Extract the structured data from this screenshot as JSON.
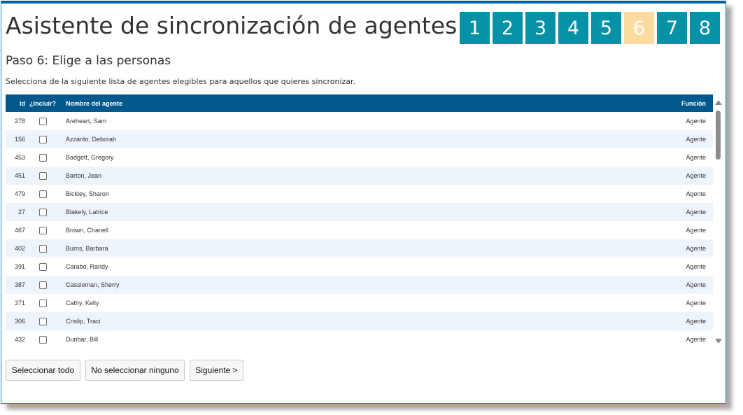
{
  "title": "Asistente de sincronización de agentes",
  "steps": [
    {
      "label": "1",
      "current": false
    },
    {
      "label": "2",
      "current": false
    },
    {
      "label": "3",
      "current": false
    },
    {
      "label": "4",
      "current": false
    },
    {
      "label": "5",
      "current": false
    },
    {
      "label": "6",
      "current": true
    },
    {
      "label": "7",
      "current": false
    },
    {
      "label": "8",
      "current": false
    }
  ],
  "subtitle": "Paso 6: Elige a las personas",
  "instructions": "Selecciona de la siguiente lista de agentes elegibles para aquellos que quieres sincronizar.",
  "table": {
    "headers": {
      "id": "Id",
      "include": "¿Incluir?",
      "name": "Nombre del agente",
      "function": "Función"
    },
    "rows": [
      {
        "id": "278",
        "name": "Areheart, Sam",
        "function": "Agente",
        "included": false
      },
      {
        "id": "156",
        "name": "Azzarito, Deborah",
        "function": "Agente",
        "included": false
      },
      {
        "id": "453",
        "name": "Badgett, Gregory",
        "function": "Agente",
        "included": false
      },
      {
        "id": "451",
        "name": "Barton, Jean",
        "function": "Agente",
        "included": false
      },
      {
        "id": "479",
        "name": "Bickley, Sharon",
        "function": "Agente",
        "included": false
      },
      {
        "id": "27",
        "name": "Blakely, Latrice",
        "function": "Agente",
        "included": false
      },
      {
        "id": "467",
        "name": "Brown, Chanell",
        "function": "Agente",
        "included": false
      },
      {
        "id": "402",
        "name": "Burns, Barbara",
        "function": "Agente",
        "included": false
      },
      {
        "id": "391",
        "name": "Carabo, Randy",
        "function": "Agente",
        "included": false
      },
      {
        "id": "387",
        "name": "Cassleman, Sherry",
        "function": "Agente",
        "included": false
      },
      {
        "id": "371",
        "name": "Cathy, Kelly",
        "function": "Agente",
        "included": false
      },
      {
        "id": "306",
        "name": "Crislip, Traci",
        "function": "Agente",
        "included": false
      },
      {
        "id": "432",
        "name": "Dunbar, Bill",
        "function": "Agente",
        "included": false
      }
    ]
  },
  "buttons": {
    "select_all": "Seleccionar todo",
    "select_none": "No seleccionar ninguno",
    "next": "Siguiente >"
  },
  "colors": {
    "step": "#0691a6",
    "step_current": "#fcdba0",
    "header": "#00588d",
    "row_alt": "#eef4fb",
    "frame": "#00659a"
  }
}
